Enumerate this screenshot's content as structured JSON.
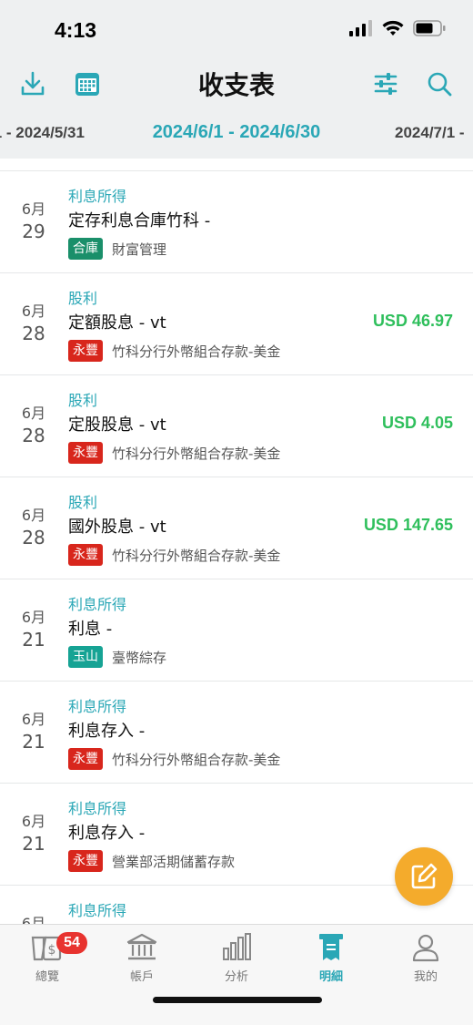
{
  "status": {
    "time": "4:13"
  },
  "nav": {
    "title": "收支表"
  },
  "period": {
    "prev": "/1 - 2024/5/31",
    "current": "2024/6/1 - 2024/6/30",
    "next": "2024/7/1 -"
  },
  "colors": {
    "accent": "#2aa7b6",
    "income": "#2fbf5c",
    "fab": "#f4ab2c",
    "badge": "#e8332f",
    "bank_heku": "#1a8f6a",
    "bank_yongfeng": "#d8261c",
    "bank_yushan": "#16a394"
  },
  "transactions": [
    {
      "month": "6月",
      "day": "29",
      "category": "利息所得",
      "description": "定存利息合庫竹科 -",
      "bank": "合庫",
      "account": "財富管理",
      "amount": ""
    },
    {
      "month": "6月",
      "day": "28",
      "category": "股利",
      "description": "定額股息 - vt",
      "bank": "永豐",
      "account": "竹科分行外幣組合存款-美金",
      "amount": "USD 46.97"
    },
    {
      "month": "6月",
      "day": "28",
      "category": "股利",
      "description": "定股股息 - vt",
      "bank": "永豐",
      "account": "竹科分行外幣組合存款-美金",
      "amount": "USD 4.05"
    },
    {
      "month": "6月",
      "day": "28",
      "category": "股利",
      "description": "國外股息 - vt",
      "bank": "永豐",
      "account": "竹科分行外幣組合存款-美金",
      "amount": "USD 147.65"
    },
    {
      "month": "6月",
      "day": "21",
      "category": "利息所得",
      "description": "利息 -",
      "bank": "玉山",
      "account": "臺幣綜存",
      "amount": ""
    },
    {
      "month": "6月",
      "day": "21",
      "category": "利息所得",
      "description": "利息存入 -",
      "bank": "永豐",
      "account": "竹科分行外幣組合存款-美金",
      "amount": ""
    },
    {
      "month": "6月",
      "day": "21",
      "category": "利息所得",
      "description": "利息存入 -",
      "bank": "永豐",
      "account": "營業部活期儲蓄存款",
      "amount": ""
    },
    {
      "month": "6月",
      "day": "",
      "category": "利息所得",
      "description": "",
      "bank": "",
      "account": "",
      "amount": ""
    }
  ],
  "tabs": [
    {
      "label": "總覽",
      "badge": "54"
    },
    {
      "label": "帳戶"
    },
    {
      "label": "分析"
    },
    {
      "label": "明細"
    },
    {
      "label": "我的"
    }
  ]
}
